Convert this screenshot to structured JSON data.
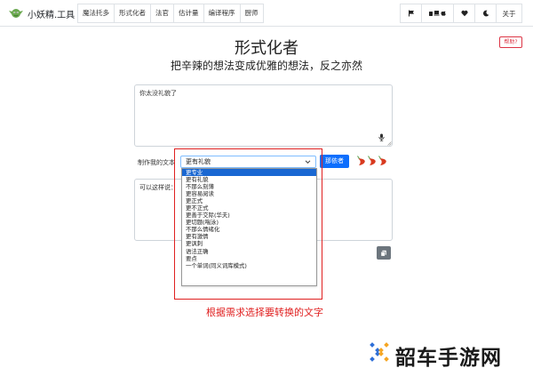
{
  "app": {
    "brand": "小妖精.工具"
  },
  "nav": {
    "tabs": [
      "魔法托多",
      "形式化者",
      "法官",
      "估计量",
      "编译程序",
      "厨师"
    ],
    "about_label": "关于"
  },
  "header": {
    "title": "形式化者",
    "subtitle": "把辛辣的想法变成优雅的想法，反之亦然",
    "help_label": "帮助?"
  },
  "input": {
    "value": "你太没礼貌了"
  },
  "controls": {
    "label": "制作我的文本",
    "selected_option": "更有礼貌",
    "submit_label": "那依者",
    "spice_icon": "chili-pepper-icon",
    "spice_level": 3
  },
  "output": {
    "value": "可以这样说："
  },
  "dropdown": {
    "options": [
      "更专业",
      "更有礼貌",
      "不那么刻薄",
      "更容易阅读",
      "更正式",
      "更不正式",
      "更善于交际(华夫)",
      "更切题(喘泳)",
      "不那么情绪化",
      "更有激情",
      "更讽刺",
      "语法正确",
      "要点",
      "一个单词(同义词库模式)"
    ],
    "highlighted_index": 0
  },
  "annotation": {
    "caption": "根据需求选择要转换的文字"
  },
  "watermark": {
    "text": "韶车手游网"
  },
  "colors": {
    "primary": "#0d6efd",
    "danger": "#dc3545",
    "annotation_red": "#e02020",
    "selected_option": "#1967d2"
  }
}
